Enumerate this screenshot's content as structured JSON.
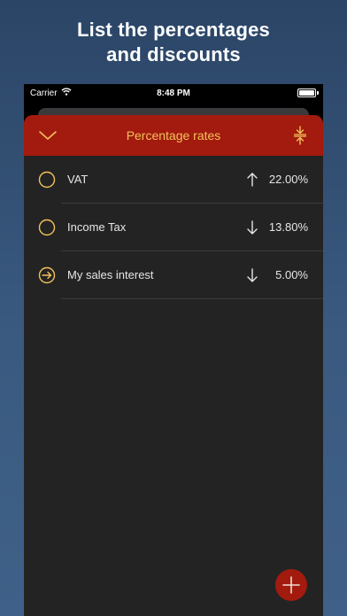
{
  "headline": {
    "line1": "List the percentages",
    "line2": "and discounts"
  },
  "status_bar": {
    "carrier": "Carrier",
    "time": "8:48 PM"
  },
  "navbar": {
    "title": "Percentage rates",
    "left_icon": "chevron-down-icon",
    "right_icon": "compress-vertical-icon"
  },
  "rates": [
    {
      "name": "VAT",
      "direction": "up",
      "value": "22.00%",
      "status_icon": "circle-icon"
    },
    {
      "name": "Income Tax",
      "direction": "down",
      "value": "13.80%",
      "status_icon": "circle-icon"
    },
    {
      "name": "My sales interest",
      "direction": "down",
      "value": "5.00%",
      "status_icon": "arrow-right-circle-icon"
    }
  ],
  "fab": {
    "icon": "plus-icon"
  },
  "colors": {
    "accent_red": "#a31a0f",
    "accent_gold": "#f2c25a",
    "background_dark": "#232323"
  }
}
